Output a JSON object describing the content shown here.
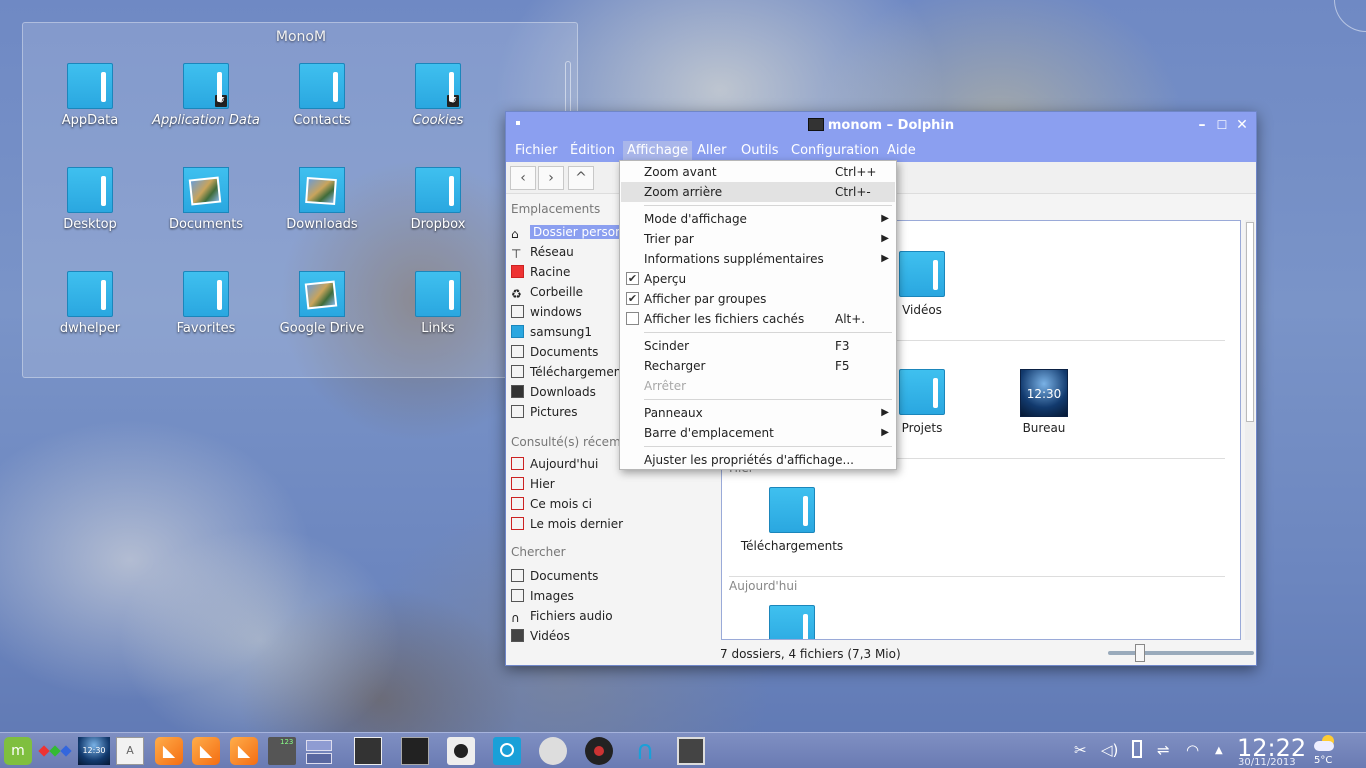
{
  "desktop": {
    "folderview_title": "MonoM",
    "icons": [
      {
        "label": "AppData"
      },
      {
        "label": "Application Data"
      },
      {
        "label": "Contacts"
      },
      {
        "label": "Cookies"
      },
      {
        "label": "Desktop"
      },
      {
        "label": "Documents"
      },
      {
        "label": "Downloads"
      },
      {
        "label": "Dropbox"
      },
      {
        "label": "dwhelper"
      },
      {
        "label": "Favorites"
      },
      {
        "label": "Google Drive"
      },
      {
        "label": "Links"
      }
    ]
  },
  "window": {
    "title": "monom – Dolphin",
    "menu": [
      "Fichier",
      "Édition",
      "Affichage",
      "Aller",
      "Outils",
      "Configuration",
      "Aide"
    ],
    "active_menu": "Affichage",
    "places": {
      "header_places": "Emplacements",
      "items": [
        {
          "label": "Dossier personnel"
        },
        {
          "label": "Réseau"
        },
        {
          "label": "Racine"
        },
        {
          "label": "Corbeille"
        },
        {
          "label": "windows"
        },
        {
          "label": "samsung1"
        },
        {
          "label": "Documents"
        },
        {
          "label": "Téléchargements"
        },
        {
          "label": "Downloads"
        },
        {
          "label": "Pictures"
        }
      ],
      "header_recent": "Consulté(s) récemment",
      "recent": [
        {
          "label": "Aujourd'hui"
        },
        {
          "label": "Hier"
        },
        {
          "label": "Ce mois ci"
        },
        {
          "label": "Le mois dernier"
        }
      ],
      "header_search": "Chercher",
      "search": [
        {
          "label": "Documents"
        },
        {
          "label": "Images"
        },
        {
          "label": "Fichiers audio"
        },
        {
          "label": "Vidéos"
        }
      ]
    },
    "content": {
      "items": [
        {
          "label": "Vidéos"
        },
        {
          "label": "Projets"
        },
        {
          "label": "Bureau"
        },
        {
          "label": "Téléchargements"
        }
      ],
      "groups": [
        "Hier",
        "Aujourd'hui"
      ],
      "bureau_time": "12:30"
    },
    "status": "7 dossiers, 4 fichiers (7,3 Mio)",
    "zoom_level": 0.2
  },
  "affichage_menu": {
    "items": [
      {
        "label": "Zoom avant",
        "shortcut": "Ctrl++"
      },
      {
        "label": "Zoom arrière",
        "shortcut": "Ctrl+-"
      },
      {
        "label": "Mode d'affichage"
      },
      {
        "label": "Trier par"
      },
      {
        "label": "Informations supplémentaires"
      },
      {
        "label": "Aperçu",
        "checked": true
      },
      {
        "label": "Afficher par groupes",
        "checked": true
      },
      {
        "label": "Afficher les fichiers cachés",
        "shortcut": "Alt+.",
        "checked": false
      },
      {
        "label": "Scinder",
        "shortcut": "F3"
      },
      {
        "label": "Recharger",
        "shortcut": "F5"
      },
      {
        "label": "Arrêter",
        "disabled": true
      },
      {
        "label": "Panneaux"
      },
      {
        "label": "Barre d'emplacement"
      },
      {
        "label": "Ajuster les propriétés d'affichage..."
      }
    ]
  },
  "taskbar": {
    "clock": "12:22",
    "date": "30/11/2013",
    "temperature": "5°C",
    "widget_time": "12:30",
    "calc_display": "123"
  },
  "colors": {
    "accent": "#8b9ff0",
    "folder": "#2aa7e0",
    "rss": "#f46d12"
  }
}
